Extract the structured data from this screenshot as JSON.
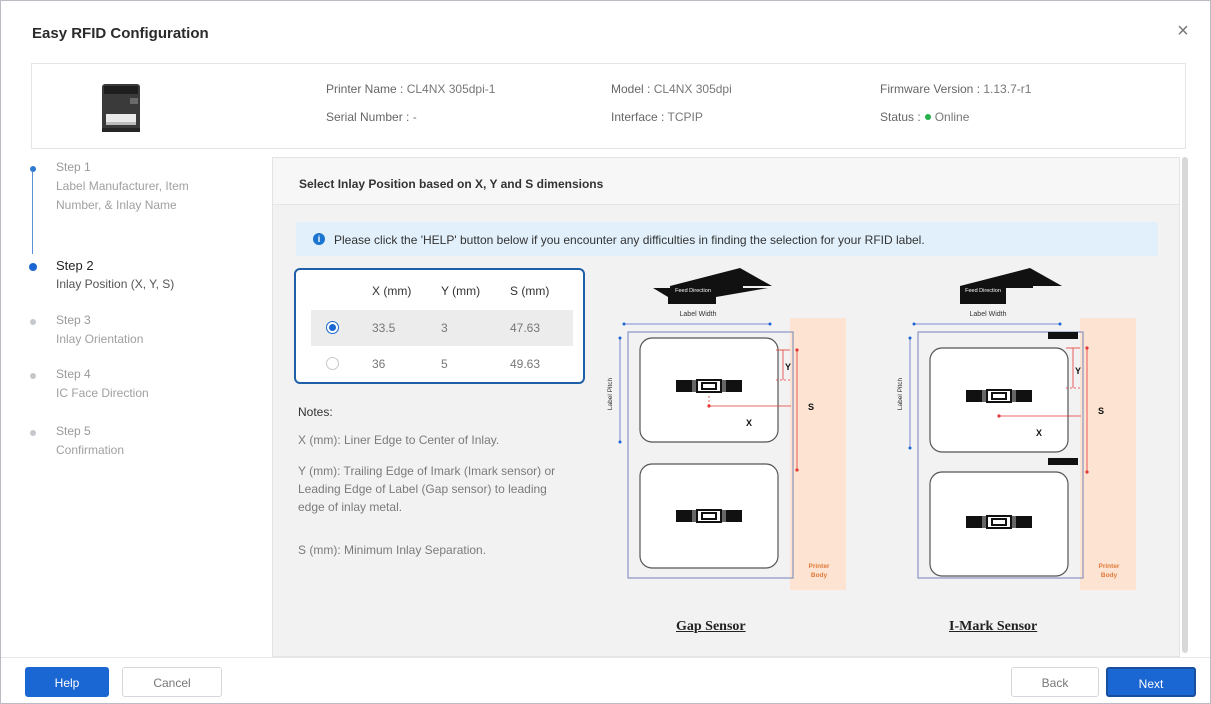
{
  "window": {
    "title": "Easy RFID Configuration",
    "close_glyph": "×"
  },
  "printer": {
    "name_label": "Printer Name :",
    "name_value": "CL4NX 305dpi-1",
    "model_label": "Model :",
    "model_value": "CL4NX 305dpi",
    "firmware_label": "Firmware Version :",
    "firmware_value": "1.13.7-r1",
    "serial_label": "Serial Number :",
    "serial_value": "-",
    "interface_label": "Interface :",
    "interface_value": "TCPIP",
    "status_label": "Status :",
    "status_value": "Online",
    "status_color": "#22b14c"
  },
  "steps": [
    {
      "num": "Step 1",
      "desc": "Label Manufacturer, Item Number, & Inlay Name",
      "state": "done"
    },
    {
      "num": "Step 2",
      "desc": "Inlay Position (X, Y, S)",
      "state": "active"
    },
    {
      "num": "Step 3",
      "desc": "Inlay Orientation",
      "state": "pending"
    },
    {
      "num": "Step 4",
      "desc": "IC Face Direction",
      "state": "pending"
    },
    {
      "num": "Step 5",
      "desc": "Confirmation",
      "state": "pending"
    }
  ],
  "panel": {
    "title": "Select Inlay Position based on X, Y and S dimensions",
    "banner": "Please click the 'HELP' button below if you encounter any difficulties in finding the selection for your RFID label.",
    "banner_icon": "info-icon"
  },
  "table": {
    "headers": [
      "X (mm)",
      "Y (mm)",
      "S (mm)"
    ],
    "rows": [
      {
        "x": "33.5",
        "y": "3",
        "s": "47.63",
        "selected": true
      },
      {
        "x": "36",
        "y": "5",
        "s": "49.63",
        "selected": false
      }
    ]
  },
  "notes": {
    "title": "Notes:",
    "items": [
      "X (mm): Liner Edge to Center of Inlay.",
      "Y (mm): Trailing Edge of Imark (Imark sensor) or Leading Edge of Label (Gap sensor) to leading edge of inlay metal.",
      "S (mm): Minimum Inlay Separation."
    ]
  },
  "diagrams": {
    "feed": "Feed Direction",
    "label_width": "Label Width",
    "label_pitch": "Label Pitch",
    "printer_body_1": "Printer",
    "printer_body_2": "Body",
    "x": "X",
    "y": "Y",
    "s": "S",
    "gap_title": "Gap Sensor",
    "imark_title": "I-Mark Sensor",
    "accent": "#e53935",
    "body_fill": "#fce3d2",
    "outline": "#8a96c2"
  },
  "buttons": {
    "help": "Help",
    "cancel": "Cancel",
    "back": "Back",
    "next": "Next"
  },
  "colors": {
    "primary": "#1a66d2"
  }
}
